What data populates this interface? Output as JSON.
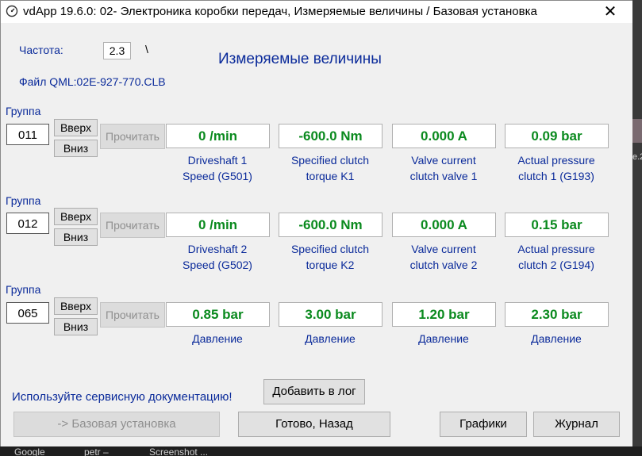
{
  "window": {
    "title": "vdApp 19.6.0: 02- Электроника коробки передач,  Измеряемые величины / Базовая установка",
    "close_glyph": "✕"
  },
  "header": {
    "freq_label": "Частота:",
    "freq_value": "2.3",
    "spinner_glyph": "\\",
    "file_label": "Файл QML:02E-927-770.CLB",
    "title": "Измеряемые величины"
  },
  "groups": [
    {
      "label": "Группа",
      "number": "011",
      "up": "Вверх",
      "down": "Вниз",
      "read": "Прочитать",
      "values": [
        "0 /min",
        "-600.0 Nm",
        "0.000 A",
        "0.09 bar"
      ],
      "captions": [
        [
          "Driveshaft 1",
          "Speed (G501)"
        ],
        [
          "Specified clutch",
          "torque K1"
        ],
        [
          "Valve current",
          "clutch valve 1"
        ],
        [
          "Actual pressure",
          "clutch 1 (G193)"
        ]
      ]
    },
    {
      "label": "Группа",
      "number": "012",
      "up": "Вверх",
      "down": "Вниз",
      "read": "Прочитать",
      "values": [
        "0 /min",
        "-600.0 Nm",
        "0.000 A",
        "0.15 bar"
      ],
      "captions": [
        [
          "Driveshaft 2",
          "Speed (G502)"
        ],
        [
          "Specified clutch",
          "torque K2"
        ],
        [
          "Valve current",
          "clutch valve 2"
        ],
        [
          "Actual pressure",
          "clutch 2 (G194)"
        ]
      ]
    },
    {
      "label": "Группа",
      "number": "065",
      "up": "Вверх",
      "down": "Вниз",
      "read": "Прочитать",
      "values": [
        "0.85 bar",
        "3.00 bar",
        "1.20 bar",
        "2.30 bar"
      ],
      "captions": [
        [
          "Давление",
          ""
        ],
        [
          "Давление",
          ""
        ],
        [
          "Давление",
          ""
        ],
        [
          "Давление",
          ""
        ]
      ]
    }
  ],
  "footer": {
    "notice": "Используйте сервисную документацию!",
    "add_log": "Добавить в лог",
    "basic_setting": "-> Базовая установка",
    "done_back": "Готово, Назад",
    "graphs": "Графики",
    "journal": "Журнал"
  },
  "taskbar": {
    "items": [
      "Google",
      "petr –",
      "Screenshot ..."
    ]
  },
  "background": {
    "snippet": "e.2"
  },
  "colors": {
    "value_text": "#0a8a1e",
    "label_text": "#0a2a9a"
  }
}
